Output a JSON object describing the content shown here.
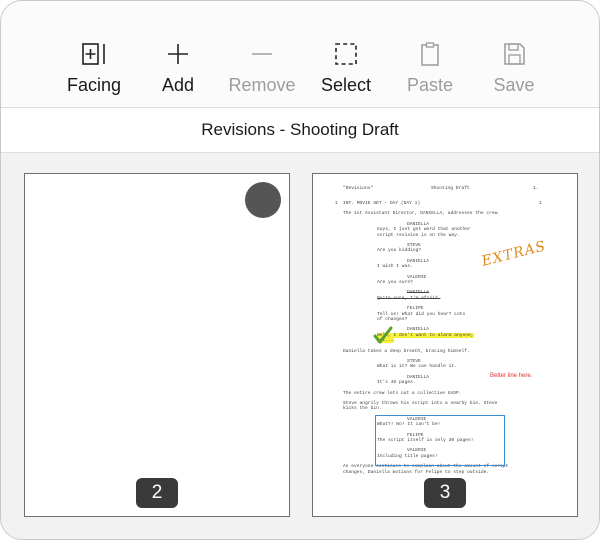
{
  "toolbar": {
    "facing": "Facing",
    "add": "Add",
    "remove": "Remove",
    "select": "Select",
    "paste": "Paste",
    "save": "Save"
  },
  "title": "Revisions - Shooting Draft",
  "pages": [
    {
      "number": "2"
    },
    {
      "number": "3"
    }
  ],
  "script_page": {
    "header_left": "\"Revisions\"",
    "header_mid": "Shooting Draft",
    "header_right": "1.",
    "lines": [
      {
        "style": "scene",
        "text": "INT. MOVIE SET - DAY (DAY 1)"
      },
      {
        "style": "action",
        "text": "The 1st Assistant Director, DANIELLA, addresses the crew."
      },
      {
        "style": "char",
        "text": "DANIELLA"
      },
      {
        "style": "dialog",
        "text": "Guys, I just got word that another\nscript revision is on the way."
      },
      {
        "style": "char",
        "text": "STEVE"
      },
      {
        "style": "dialog",
        "text": "Are you kidding?"
      },
      {
        "style": "char",
        "text": "DANIELLA"
      },
      {
        "style": "dialog",
        "text": "I wish I was."
      },
      {
        "style": "char",
        "text": "VALERIE"
      },
      {
        "style": "dialog",
        "text": "Are you sure?"
      },
      {
        "style": "char-strike",
        "text": "DANIELLA"
      },
      {
        "style": "dialog-strike",
        "text": "Quite sure, I'm afraid."
      },
      {
        "style": "char",
        "text": "FELIPE"
      },
      {
        "style": "dialog",
        "text": "Tell us! What did you hear? Lots\nof changes?"
      },
      {
        "style": "char",
        "text": "DANIELLA"
      },
      {
        "style": "dialog-hl",
        "text": "Well, I don't want to alarm anyone,\nbut..."
      },
      {
        "style": "action",
        "text": "Daniella takes a deep breath, bracing himself."
      },
      {
        "style": "char",
        "text": "STEVE"
      },
      {
        "style": "dialog",
        "text": "What is it? We can handle it."
      },
      {
        "style": "char",
        "text": "DANIELLA"
      },
      {
        "style": "dialog",
        "text": "It's 36 pages."
      },
      {
        "style": "action",
        "text": "The entire crew lets out a collective GASP."
      },
      {
        "style": "action",
        "text": "Steve angrily throws his script into a nearby bin. Steve\nkicks the bin."
      },
      {
        "style": "char",
        "text": "VALERIE"
      },
      {
        "style": "dialog",
        "text": "What?! No! It can't be!"
      },
      {
        "style": "char",
        "text": "FELIPE"
      },
      {
        "style": "dialog",
        "text": "The script itself is only 30 pages!"
      },
      {
        "style": "char",
        "text": "VALERIE"
      },
      {
        "style": "dialog",
        "text": "Including title pages!"
      },
      {
        "style": "action",
        "text": "As everyone continues to complain about the amount of script\nchanges, Daniella motions for Felipe to step outside."
      }
    ],
    "scene_number": "1",
    "annotation_extras": "EXTRAS",
    "annotation_note": "Better line here."
  },
  "colors": {
    "extras": "#e08a1e",
    "note": "#e0342b",
    "box": "#3d8ed8",
    "check": "#5aa02c",
    "highlight": "#f6f23c"
  }
}
